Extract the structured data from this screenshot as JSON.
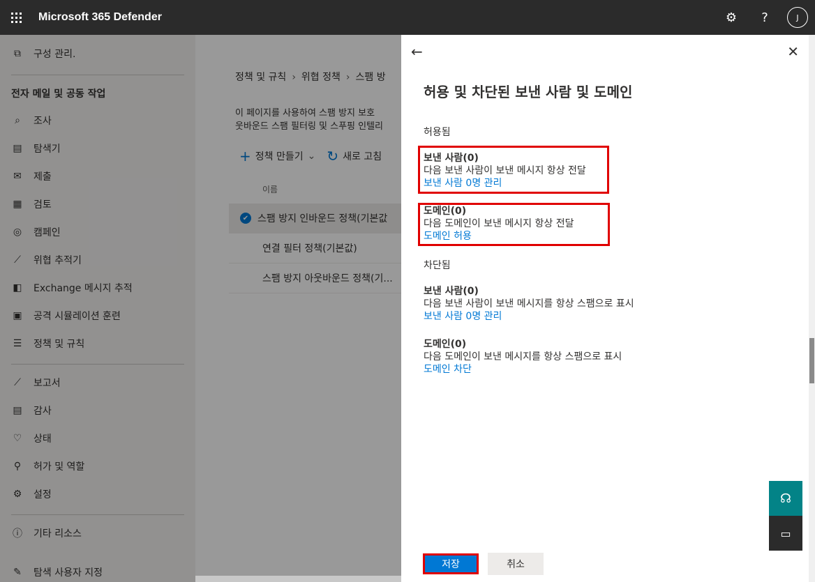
{
  "app": {
    "title": "Microsoft 365 Defender"
  },
  "topbar": {
    "settings_icon": "⚙",
    "help_icon": "?",
    "avatar_initial": "J"
  },
  "nav": {
    "config_item": "구성 관리.",
    "section_header": "전자 메일 및 공동 작업",
    "items": [
      {
        "label": "조사",
        "icon": "investigation-icon"
      },
      {
        "label": "탐색기",
        "icon": "explorer-icon"
      },
      {
        "label": "제출",
        "icon": "submissions-icon"
      },
      {
        "label": "검토",
        "icon": "review-icon"
      },
      {
        "label": "캠페인",
        "icon": "campaigns-icon"
      },
      {
        "label": "위협 추적기",
        "icon": "threat-tracker-icon"
      },
      {
        "label": "Exchange 메시지 추적",
        "icon": "exchange-icon"
      },
      {
        "label": "공격 시뮬레이션 훈련",
        "icon": "attack-simulation-icon"
      },
      {
        "label": "정책 및 규칙",
        "icon": "policies-icon"
      }
    ],
    "bottom_items": [
      {
        "label": "보고서",
        "icon": "reports-icon"
      },
      {
        "label": "감사",
        "icon": "audit-icon"
      },
      {
        "label": "상태",
        "icon": "health-icon"
      },
      {
        "label": "허가 및 역할",
        "icon": "permissions-icon"
      },
      {
        "label": "설정",
        "icon": "settings-icon"
      }
    ],
    "more_resources": "기타 리소스",
    "customize": "탐색 사용자 지정"
  },
  "main": {
    "breadcrumb": [
      "정책 및 규칙",
      "위협 정책",
      "스팸 방"
    ],
    "description_line1": "이 페이지를 사용하여 스팸 방지 보호",
    "description_line2": "웃바운드 스팸 필터링 및 스푸핑 인텔리",
    "create_policy": "정책 만들기",
    "refresh": "새로 고침",
    "column_name": "이름",
    "policies": [
      {
        "name": "스팸 방지 인바운드 정책(기본값",
        "selected": true
      },
      {
        "name": "연결 필터 정책(기본값)",
        "selected": false
      },
      {
        "name": "스팸 방지 아웃바운드 정책(기...",
        "selected": false
      }
    ]
  },
  "panel": {
    "title": "허용 및 차단된 보낸 사람 및 도메인",
    "allowed_label": "허용됨",
    "allowed_senders": {
      "heading": "보낸 사람(0)",
      "desc": "다음 보낸 사람이 보낸 메시지 항상 전달",
      "link": "보낸 사람 0명 관리"
    },
    "allowed_domains": {
      "heading": "도메인(0)",
      "desc": "다음 도메인이 보낸 메시지 항상 전달",
      "link": "도메인 허용"
    },
    "blocked_label": "차단됨",
    "blocked_senders": {
      "heading": "보낸 사람(0)",
      "desc": "다음 보낸 사람이 보낸 메시지를 항상 스팸으로 표시",
      "link": "보낸 사람 0명 관리"
    },
    "blocked_domains": {
      "heading": "도메인(0)",
      "desc": "다음 도메인이 보낸 메시지를 항상 스팸으로 표시",
      "link": "도메인 차단"
    },
    "save": "저장",
    "cancel": "취소"
  }
}
